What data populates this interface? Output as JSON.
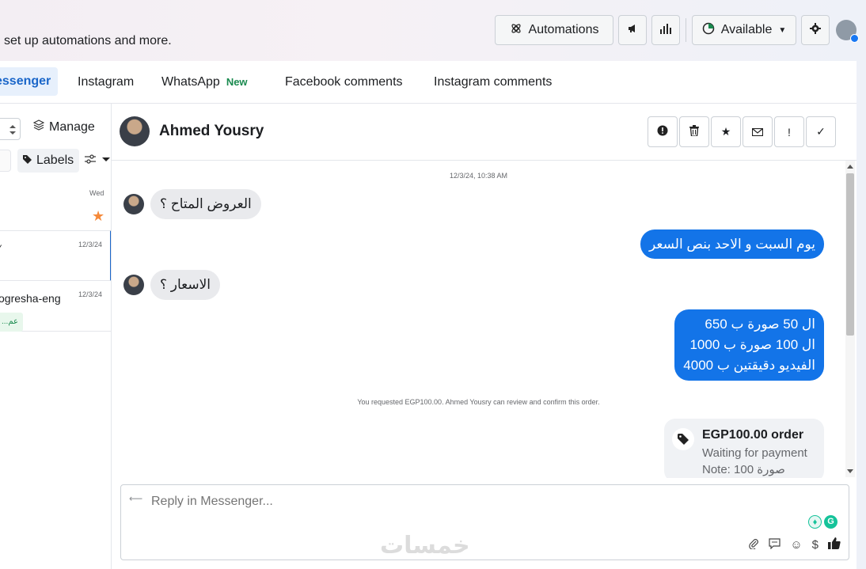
{
  "header": {
    "subtitle": "set up automations and more.",
    "automations_label": "Automations",
    "status_label": "Available"
  },
  "tabs": [
    {
      "label": "essenger"
    },
    {
      "label": "Instagram"
    },
    {
      "label": "WhatsApp",
      "badge": "New"
    },
    {
      "label": "Facebook comments"
    },
    {
      "label": "Instagram comments"
    }
  ],
  "sidebar": {
    "manage_label": "Manage",
    "labels_label": "Labels",
    "rows": [
      {
        "time": "Wed"
      },
      {
        "time": "12/3/24"
      },
      {
        "time": "12/3/24",
        "name": "ogresha-eng",
        "tag": "...عم"
      }
    ]
  },
  "chat": {
    "contact_name": "Ahmed Yousry",
    "date": "12/3/24, 10:38 AM",
    "messages": [
      {
        "dir": "in",
        "text": "العروض المتاح ؟"
      },
      {
        "dir": "out",
        "text": "يوم السبت و الاحد بنص السعر"
      },
      {
        "dir": "in",
        "text": "الاسعار ؟"
      },
      {
        "dir": "out",
        "lines": [
          "ال 50 صورة ب 650",
          "ال 100 صورة ب 1000",
          "الفيديو دقيقتين ب 4000"
        ]
      }
    ],
    "system_note": "You requested EGP100.00. Ahmed Yousry can review and confirm this order.",
    "order": {
      "title": "EGP100.00 order",
      "status": "Waiting for payment",
      "note": "Note: 100 صورة"
    },
    "reply_placeholder": "Reply in Messenger..."
  },
  "watermark": "خمسات",
  "colors": {
    "accent": "#1374e8",
    "active_tab_text": "#1a66c9",
    "new_badge": "#1a8a4f",
    "star": "#f5893a"
  }
}
